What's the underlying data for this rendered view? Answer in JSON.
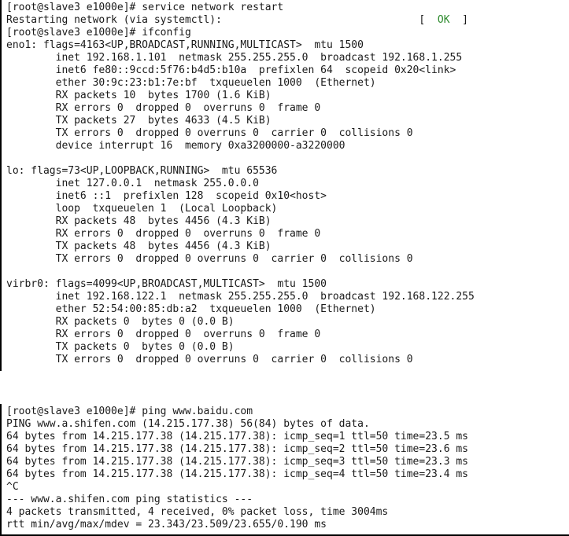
{
  "top": {
    "prompt": "[root@slave3 e1000e]# ",
    "cmd_restart": "service network restart",
    "restart_msg_left": "Restarting network (via systemctl):",
    "restart_pad": "                                ",
    "bracket_l": "[  ",
    "ok": "OK",
    "bracket_r": "  ]",
    "cmd_ifconfig": "ifconfig",
    "eno1_l1": "eno1: flags=4163<UP,BROADCAST,RUNNING,MULTICAST>  mtu 1500",
    "eno1_l2": "        inet 192.168.1.101  netmask 255.255.255.0  broadcast 192.168.1.255",
    "eno1_l3": "        inet6 fe80::9ccd:5f76:b4d5:b10a  prefixlen 64  scopeid 0x20<link>",
    "eno1_l4": "        ether 30:9c:23:b1:7e:bf  txqueuelen 1000  (Ethernet)",
    "eno1_l5": "        RX packets 10  bytes 1700 (1.6 KiB)",
    "eno1_l6": "        RX errors 0  dropped 0  overruns 0  frame 0",
    "eno1_l7": "        TX packets 27  bytes 4633 (4.5 KiB)",
    "eno1_l8": "        TX errors 0  dropped 0 overruns 0  carrier 0  collisions 0",
    "eno1_l9": "        device interrupt 16  memory 0xa3200000-a3220000",
    "lo_l1": "lo: flags=73<UP,LOOPBACK,RUNNING>  mtu 65536",
    "lo_l2": "        inet 127.0.0.1  netmask 255.0.0.0",
    "lo_l3": "        inet6 ::1  prefixlen 128  scopeid 0x10<host>",
    "lo_l4": "        loop  txqueuelen 1  (Local Loopback)",
    "lo_l5": "        RX packets 48  bytes 4456 (4.3 KiB)",
    "lo_l6": "        RX errors 0  dropped 0  overruns 0  frame 0",
    "lo_l7": "        TX packets 48  bytes 4456 (4.3 KiB)",
    "lo_l8": "        TX errors 0  dropped 0 overruns 0  carrier 0  collisions 0",
    "vb_l1": "virbr0: flags=4099<UP,BROADCAST,MULTICAST>  mtu 1500",
    "vb_l2": "        inet 192.168.122.1  netmask 255.255.255.0  broadcast 192.168.122.255",
    "vb_l3": "        ether 52:54:00:85:db:a2  txqueuelen 1000  (Ethernet)",
    "vb_l4": "        RX packets 0  bytes 0 (0.0 B)",
    "vb_l5": "        RX errors 0  dropped 0  overruns 0  frame 0",
    "vb_l6": "        TX packets 0  bytes 0 (0.0 B)",
    "vb_l7": "        TX errors 0  dropped 0 overruns 0  carrier 0  collisions 0"
  },
  "bot": {
    "prompt": "[root@slave3 e1000e]# ",
    "cmd_ping": "ping www.baidu.com",
    "l1": "PING www.a.shifen.com (14.215.177.38) 56(84) bytes of data.",
    "l2": "64 bytes from 14.215.177.38 (14.215.177.38): icmp_seq=1 ttl=50 time=23.5 ms",
    "l3": "64 bytes from 14.215.177.38 (14.215.177.38): icmp_seq=2 ttl=50 time=23.6 ms",
    "l4": "64 bytes from 14.215.177.38 (14.215.177.38): icmp_seq=3 ttl=50 time=23.3 ms",
    "l5": "64 bytes from 14.215.177.38 (14.215.177.38): icmp_seq=4 ttl=50 time=23.4 ms",
    "l6": "^C",
    "l7": "--- www.a.shifen.com ping statistics ---",
    "l8": "4 packets transmitted, 4 received, 0% packet loss, time 3004ms",
    "l9": "rtt min/avg/max/mdev = 23.343/23.509/23.655/0.190 ms"
  }
}
